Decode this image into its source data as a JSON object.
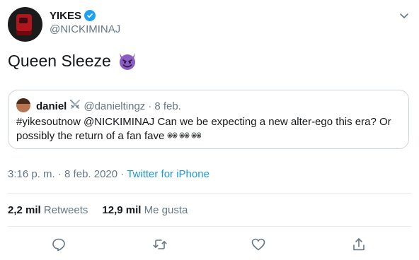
{
  "author": {
    "display_name": "YIKES",
    "handle": "@NICKIMINAJ",
    "verified": true
  },
  "tweet": {
    "text": "Queen Sleeze",
    "emoji": "smiling-imp-emoji"
  },
  "quoted": {
    "name": "daniel",
    "name_emoji": "crossed-swords-emoji",
    "handle": "@danieltingz",
    "dot": "·",
    "date": "8 feb.",
    "text": "#yikesoutnow @NICKIMINAJ Can we be expecting a new alter-ego this era? Or possibly the return of a fan fave",
    "trailing_emoji": "eyes-emoji"
  },
  "meta": {
    "time": "3:16 p. m.",
    "date": "8 feb. 2020",
    "sep": "·",
    "source": "Twitter for iPhone"
  },
  "stats": {
    "retweets_count": "2,2 mil",
    "retweets_label": "Retweets",
    "likes_count": "12,9 mil",
    "likes_label": "Me gusta"
  },
  "colors": {
    "accent": "#1da1f2",
    "link": "#1b95e0",
    "secondary_text": "#657786",
    "border": "#ccd6dd"
  }
}
